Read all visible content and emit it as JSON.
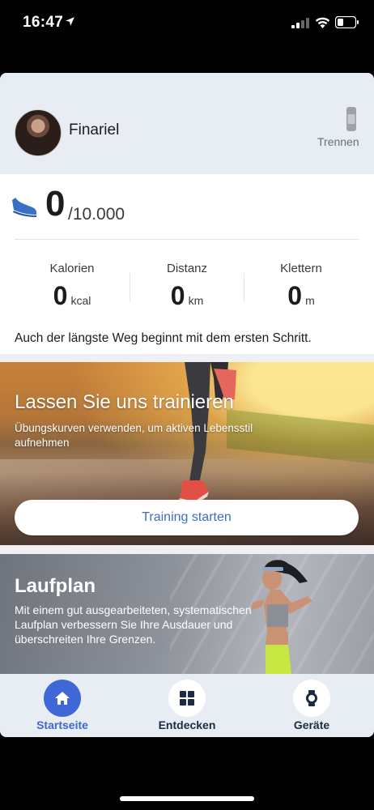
{
  "status_bar": {
    "time": "16:47",
    "icons": [
      "location-arrow-icon",
      "signal-icon",
      "wifi-icon",
      "battery-icon"
    ]
  },
  "profile": {
    "name": "Finariel",
    "disconnect_label": "Trennen",
    "disconnect_icon": "watch-icon"
  },
  "steps": {
    "icon": "shoe-icon",
    "value": "0",
    "goal": "/10.000",
    "metrics": [
      {
        "label": "Kalorien",
        "value": "0",
        "unit": "kcal"
      },
      {
        "label": "Distanz",
        "value": "0",
        "unit": "km"
      },
      {
        "label": "Klettern",
        "value": "0",
        "unit": "m"
      }
    ]
  },
  "motto": "Auch der längste Weg beginnt mit dem ersten Schritt.",
  "training": {
    "title": "Lassen Sie uns trainieren",
    "subtitle": "Übungskurven verwenden, um aktiven Lebensstil aufnehmen",
    "button": "Training starten"
  },
  "run_plan": {
    "title": "Laufplan",
    "subtitle": "Mit einem gut ausgearbeiteten, systematischen Laufplan verbessern Sie Ihre Ausdauer und überschreiten Ihre Grenzen."
  },
  "tabs": [
    {
      "label": "Startseite",
      "icon": "home-icon",
      "active": true
    },
    {
      "label": "Entdecken",
      "icon": "grid-icon",
      "active": false
    },
    {
      "label": "Geräte",
      "icon": "watch-icon",
      "active": false
    }
  ],
  "colors": {
    "accent": "#3f67d6",
    "button_text": "#3a6fc4",
    "header_bg": "#e7edf3",
    "shoe": "#3a6fc4"
  }
}
